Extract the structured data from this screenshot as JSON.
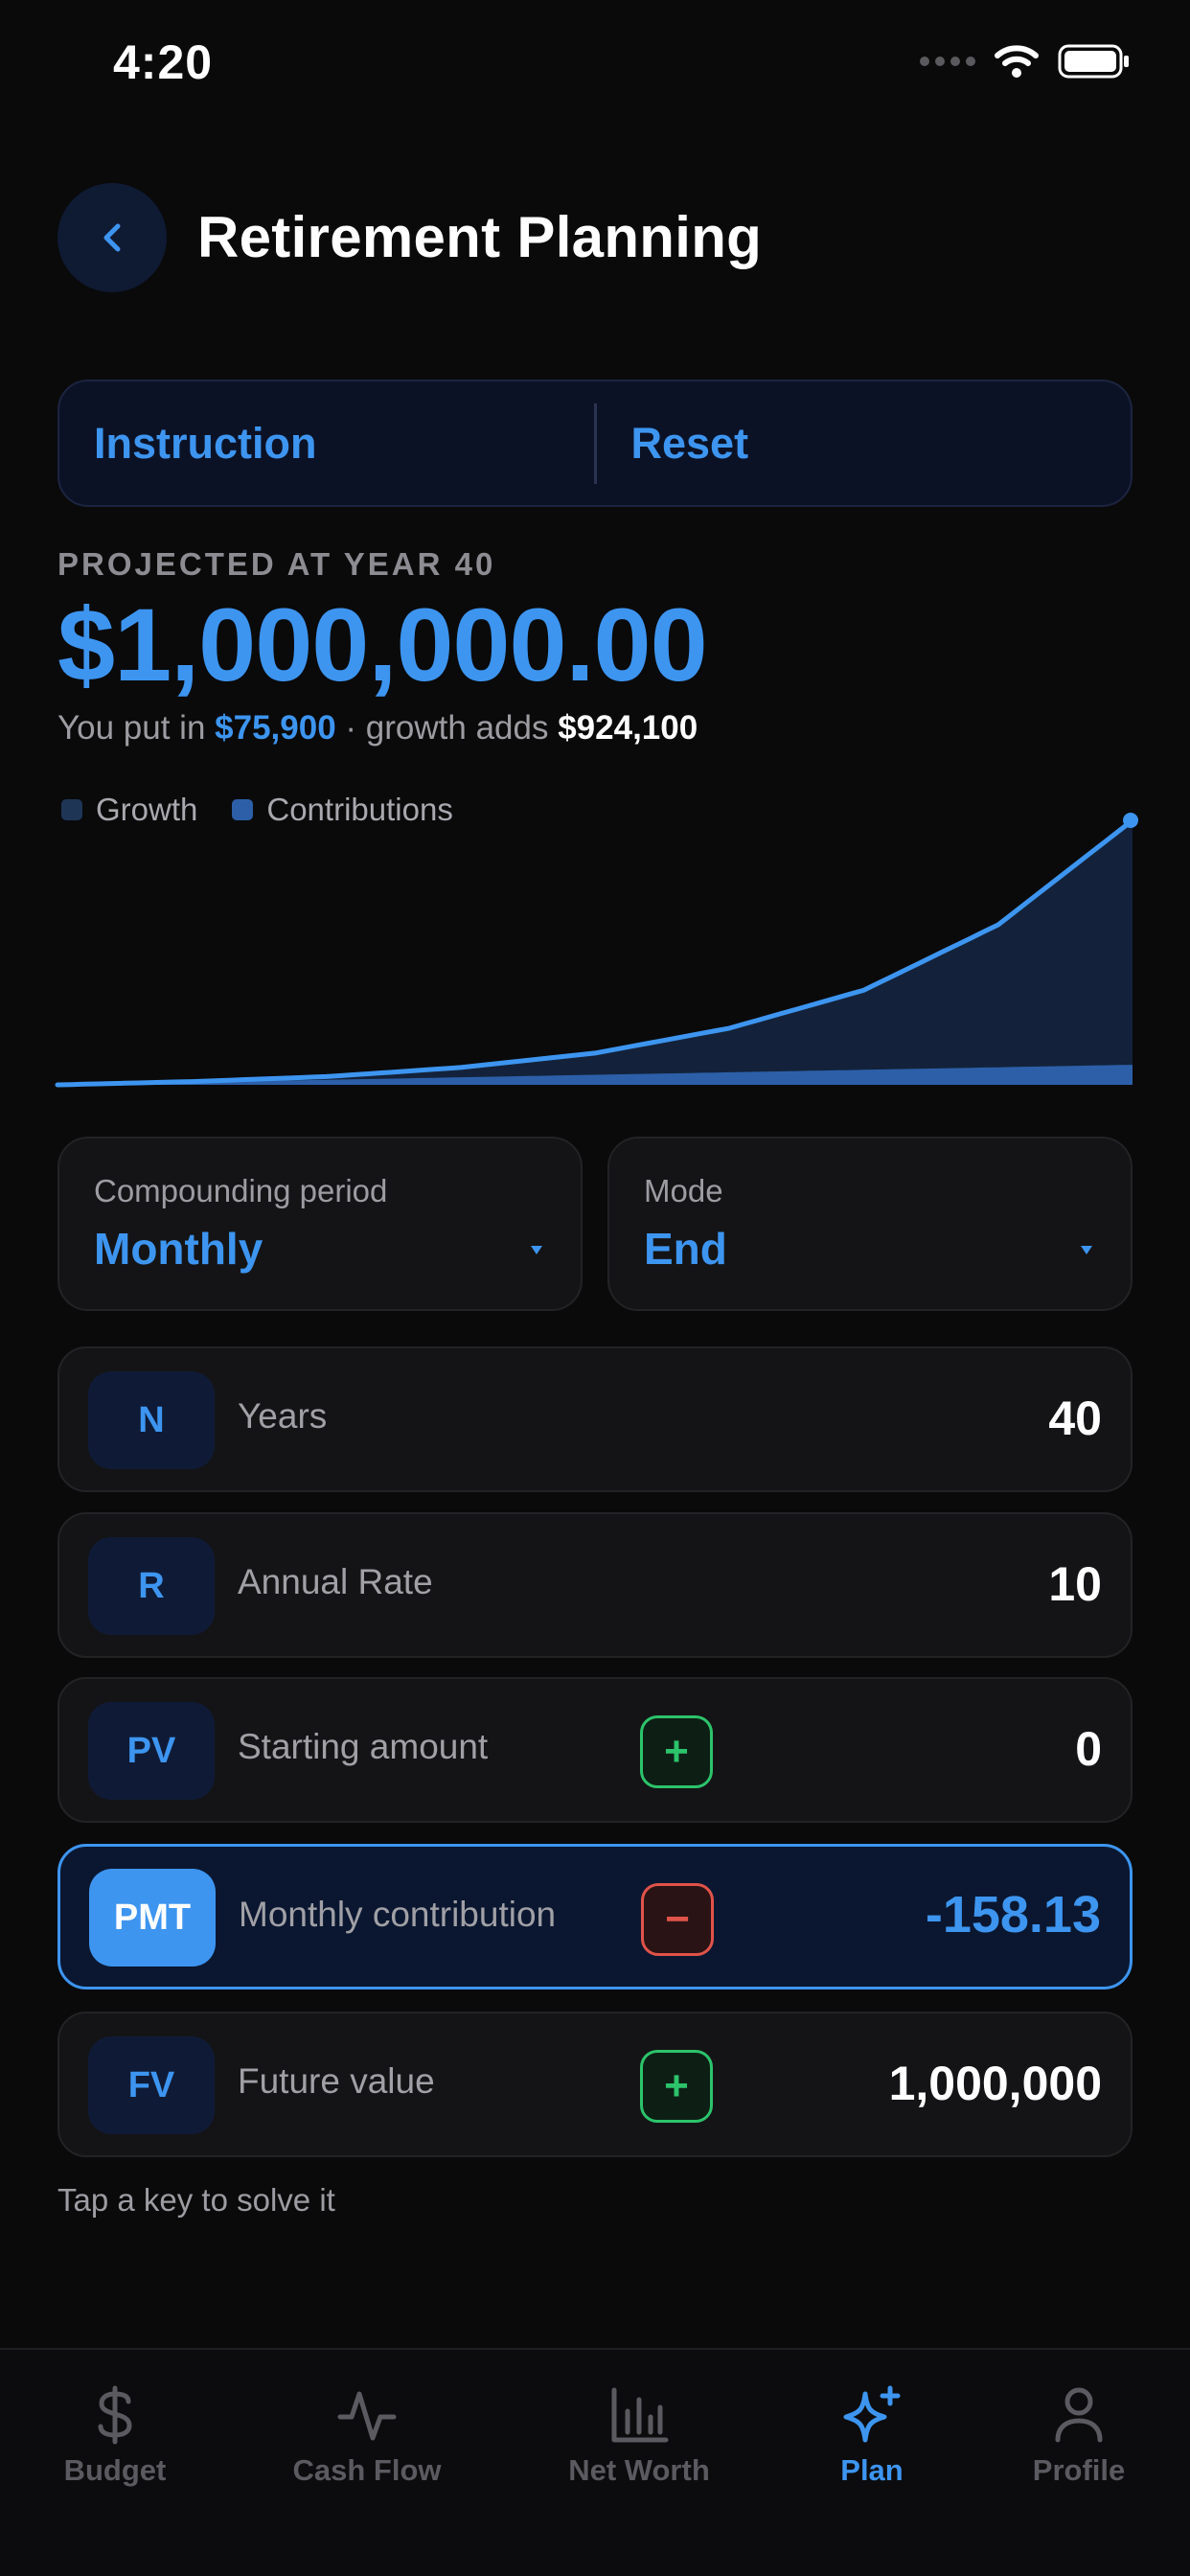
{
  "status_bar": {
    "time": "4:20"
  },
  "header": {
    "title": "Retirement Planning"
  },
  "segment": {
    "instruction_label": "Instruction",
    "reset_label": "Reset"
  },
  "projection": {
    "label": "PROJECTED AT YEAR 40",
    "value": "$1,000,000.00",
    "put_in_prefix": "You put in",
    "put_in_amount": "$75,900",
    "growth_prefix": "· growth adds",
    "growth_amount": "$924,100"
  },
  "chart_data": {
    "type": "area",
    "legend": [
      {
        "name": "Growth",
        "color": "#1e3556"
      },
      {
        "name": "Contributions",
        "color": "#2c5fa8"
      }
    ],
    "x": [
      0,
      5,
      10,
      15,
      20,
      25,
      30,
      35,
      40
    ],
    "series": [
      {
        "name": "Contributions",
        "values": [
          0,
          9488,
          18975,
          28463,
          37950,
          47438,
          56925,
          66413,
          75900
        ]
      },
      {
        "name": "Growth",
        "values": [
          0,
          2806,
          12074,
          37014,
          82052,
          166780,
          300780,
          538580,
          924100
        ]
      }
    ],
    "ylim": [
      0,
      1000000
    ],
    "colors": {
      "line": "#3d95f0",
      "growth_fill": "#13223a",
      "contrib_fill": "#2c5fa8"
    }
  },
  "compounding": {
    "label": "Compounding period",
    "value": "Monthly"
  },
  "mode": {
    "label": "Mode",
    "value": "End"
  },
  "keys": {
    "n": {
      "badge": "N",
      "label": "Years",
      "value": "40"
    },
    "r": {
      "badge": "R",
      "label": "Annual Rate",
      "value": "10"
    },
    "pv": {
      "badge": "PV",
      "label": "Starting amount",
      "sign": "+",
      "value": "0"
    },
    "pmt": {
      "badge": "PMT",
      "label": "Monthly contribution",
      "sign": "−",
      "value": "-158.13"
    },
    "fv": {
      "badge": "FV",
      "label": "Future value",
      "sign": "+",
      "value": "1,000,000"
    }
  },
  "hint": "Tap a key to solve it",
  "tabs": {
    "budget": "Budget",
    "cash_flow": "Cash Flow",
    "net_worth": "Net Worth",
    "plan": "Plan",
    "profile": "Profile"
  },
  "colors": {
    "accent": "#3d95f0",
    "positive": "#2cc36b",
    "negative": "#e0534a",
    "background": "#0a0a0b"
  }
}
